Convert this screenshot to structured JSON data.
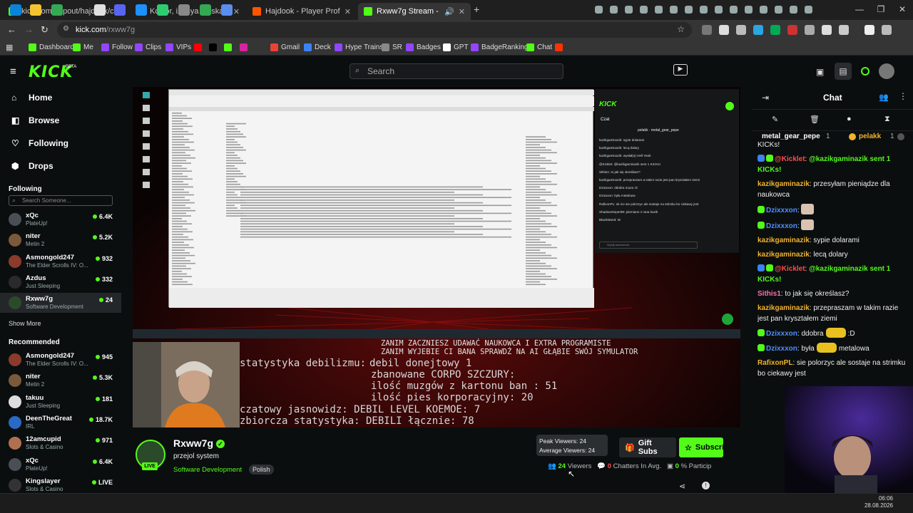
{
  "browser": {
    "tabs": [
      {
        "title": "kick.com/popout/hajdook/chat",
        "color": "#53fc18"
      },
      {
        "title": "Kosior, izonya polska - NIE MA",
        "color": "#ff0000"
      },
      {
        "title": "Hajdook - Player Profile - FACE",
        "color": "#ff5500"
      },
      {
        "title": "Rxww7g Stream - Watch Li",
        "color": "#53fc18"
      }
    ],
    "new_tab": "+",
    "url_host": "kick.com",
    "url_path": "/rxww7g",
    "bookmarks": [
      {
        "label": "Dashboard",
        "color": "#53fc18"
      },
      {
        "label": "Me",
        "color": "#53fc18"
      },
      {
        "label": "Follow",
        "color": "#9146ff"
      },
      {
        "label": "Clips",
        "color": "#9146ff"
      },
      {
        "label": "VIPs",
        "color": "#9146ff"
      },
      {
        "label": "",
        "color": "#ff0000"
      },
      {
        "label": "",
        "color": "#000000"
      },
      {
        "label": "",
        "color": "#53fc18"
      },
      {
        "label": "",
        "color": "#d6249f"
      },
      {
        "label": "Gmail",
        "color": "#ea4335"
      },
      {
        "label": "Deck",
        "color": "#3b82f6"
      },
      {
        "label": "Hype Trains",
        "color": "#9146ff"
      },
      {
        "label": "SR",
        "color": "#888888"
      },
      {
        "label": "Badges",
        "color": "#9146ff"
      },
      {
        "label": "GPT",
        "color": "#ffffff"
      },
      {
        "label": "BadgeRanking",
        "color": "#9146ff"
      },
      {
        "label": "Chat",
        "color": "#53fc18"
      },
      {
        "label": "",
        "color": "#ff3300"
      }
    ]
  },
  "header": {
    "logo": "KICK",
    "beta": "BETA",
    "search_placeholder": "Search"
  },
  "sidebar": {
    "nav": [
      {
        "label": "Home",
        "icon": "home-icon",
        "glyph": "⌂"
      },
      {
        "label": "Browse",
        "icon": "browse-icon",
        "glyph": "◧"
      },
      {
        "label": "Following",
        "icon": "heart-icon",
        "glyph": "♡"
      },
      {
        "label": "Drops",
        "icon": "drops-icon",
        "glyph": "⬢"
      }
    ],
    "following_title": "Following",
    "search_placeholder": "Search Someone...",
    "following": [
      {
        "name": "xQc",
        "category": "PlateUp!",
        "viewers": "6.4K",
        "color": "#4a4f55"
      },
      {
        "name": "niter",
        "category": "Metin 2",
        "viewers": "5.2K",
        "color": "#7a5a3a"
      },
      {
        "name": "Asmongold247",
        "category": "The Elder Scrolls IV: O...",
        "viewers": "932",
        "color": "#8a3b2b"
      },
      {
        "name": "Azdus",
        "category": "Just Sleeping",
        "viewers": "332",
        "color": "#2a2a2a"
      },
      {
        "name": "Rxww7g",
        "category": "Software Development",
        "viewers": "24",
        "color": "#2b4a2a"
      }
    ],
    "show_more": "Show More",
    "recommended_title": "Recommended",
    "recommended": [
      {
        "name": "Asmongold247",
        "category": "The Elder Scrolls IV: O...",
        "viewers": "945",
        "color": "#8a3b2b"
      },
      {
        "name": "niter",
        "category": "Metin 2",
        "viewers": "5.3K",
        "color": "#7a5a3a"
      },
      {
        "name": "takuu",
        "category": "Just Sleeping",
        "viewers": "181",
        "color": "#ddd"
      },
      {
        "name": "DeenTheGreat",
        "category": "IRL",
        "viewers": "18.7K",
        "color": "#2a6ac7"
      },
      {
        "name": "12amcupid",
        "category": "Slots & Casino",
        "viewers": "971",
        "color": "#b07050"
      },
      {
        "name": "xQc",
        "category": "PlateUp!",
        "viewers": "6.4K",
        "color": "#4a4f55"
      },
      {
        "name": "Kingslayer",
        "category": "Slots & Casino",
        "viewers": "LIVE",
        "color": "#333"
      }
    ]
  },
  "stream": {
    "overlay_lines": [
      "ZANIM ZACZNIESZ UDAWAĆ NAUKOWCA I EXTRA PROGRAMISTE",
      "ZANIM WYJEBIE CI BANA SPRAWDŹ NA AI GŁĄBIE SWÓJ SYMULATOR"
    ],
    "stats_label": "statystyka debilizmu:",
    "stats_lines": [
      "debil donejtowy 1",
      "zbanowane CORPO SZCZURY:",
      "ilość muzgów z kartonu ban : 51",
      "ilość pies korporacyjny: 20"
    ],
    "footer_lines": [
      "czatowy jasnowidz: DEBIL LEVEL KOEMOE: 7",
      "zbiorcza statystyka: DEBILI łącznie: 78"
    ],
    "mini_kick": {
      "logo": "KICK",
      "chat_title": "Czat",
      "pinned_a": "pelakk",
      "pinned_b": "metal_gear_pepe",
      "placeholder": "Wyślij wiadomość",
      "messages": [
        "kazikgaminazik: sypie dolarami",
        "kazikgaminazik: lecą dolary",
        "kazikgaminazik: wysłał(a) Hell Yeah",
        "@Kicklet: @kazikgaminazik sent 1 KICKs!",
        "Sithis1: to jak się określasz?",
        "kazikgaminazik: przepraszam w takim razie jest pan kryształem ziemi",
        "Dzixxxon: ddobra muza :D",
        "Dzixxxon: była metalowa",
        "RafixonPL: ok ice sie polorzyc ale sostaje na strimku bo ciekawy jest",
        "ShadowSniper99: pierniano z rana kazik",
        "BlackWand: W"
      ]
    }
  },
  "channel": {
    "name": "Rxww7g",
    "title": "przejol system",
    "category": "Software Development",
    "tag": "Polish",
    "live": "LIVE",
    "tooltip_peak": "Peak Viewers: 24",
    "tooltip_avg": "Average Viewers: 24",
    "gift_label": "Gift Subs",
    "subscribe_label": "Subscri",
    "viewers_count": "24",
    "viewers_label": "Viewers",
    "chatters_count": "0",
    "chatters_label": "Chatters In Avg.",
    "particip_count": "0",
    "particip_label": "% Particip"
  },
  "chat": {
    "title": "Chat",
    "pinned_left": "metal_gear_pepe",
    "pinned_left_count": "1",
    "pinned_right": "pelakk",
    "pinned_right_count": "1",
    "messages": [
      {
        "user": "",
        "text": "KICKs!",
        "color": "#ffffff"
      },
      {
        "user": "@Kicklet",
        "text": "@kazikgaminazik sent 1 KICKs!",
        "color": "#ff4d4d",
        "badges": true,
        "mention": true
      },
      {
        "user": "kazikgaminazik",
        "text": "przesyłam pieniądze dla naukowca",
        "color": "#f2b32e"
      },
      {
        "user": "Dzixxxon",
        "text": "",
        "color": "#4d8fff",
        "badge1": true,
        "emote": true
      },
      {
        "user": "Dzixxxon",
        "text": "",
        "color": "#4d8fff",
        "badge1": true,
        "emote": true
      },
      {
        "user": "kazikgaminazik",
        "text": "sypie dolarami",
        "color": "#f2b32e"
      },
      {
        "user": "kazikgaminazik",
        "text": "lecą dolary",
        "color": "#f2b32e"
      },
      {
        "user": "@Kicklet",
        "text": "@kazikgaminazik sent 1 KICKs!",
        "color": "#ff4d4d",
        "badges": true,
        "mention": true
      },
      {
        "user": "Sithis1",
        "text": "to jak się określasz?",
        "color": "#ff6fae"
      },
      {
        "user": "kazikgaminazik",
        "text": "przepraszam w takim razie jest pan kryształem ziemi",
        "color": "#f2b32e"
      },
      {
        "user": "Dzixxxon",
        "text": "ddobra",
        "tail": ":D",
        "color": "#4d8fff",
        "badge1": true,
        "emote": true
      },
      {
        "user": "Dzixxxon",
        "text": "była",
        "tail": "metalowa",
        "color": "#4d8fff",
        "badge1": true,
        "emote": true
      },
      {
        "user": "RafixonPL",
        "text": "sie polorzyc ale sostaje na strimku bo ciekawy jest",
        "color": "#f2b32e",
        "emote": true
      }
    ]
  },
  "taskbar": {
    "time": "06:06",
    "date": "28.08.2026"
  },
  "colors": {
    "accent": "#53fc18",
    "bg": "#0b0e0f"
  }
}
